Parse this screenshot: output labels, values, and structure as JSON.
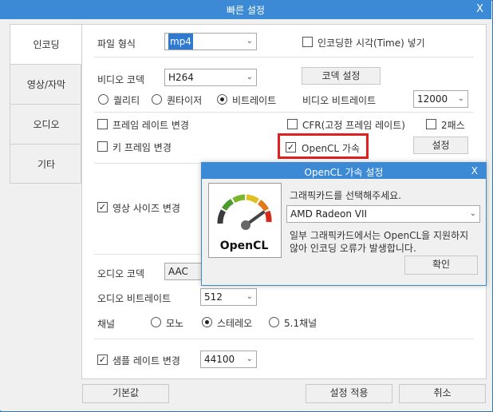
{
  "window": {
    "title": "빠른 설정",
    "close": "X"
  },
  "nav": {
    "items": [
      "인코딩",
      "영상/자막",
      "오디오",
      "기타"
    ]
  },
  "encoding": {
    "file_format_label": "파일 형식",
    "file_format_value": "mp4",
    "insert_time_label": "인코딩한 시각(Time) 넣기",
    "insert_time_checked": false,
    "video_codec_label": "비디오 코덱",
    "video_codec_value": "H264",
    "codec_settings_button": "코덱 설정",
    "modes": {
      "quality": "퀄리티",
      "quantizer": "퀀타이저",
      "bitrate": "비트레이트",
      "selected": "bitrate"
    },
    "video_bitrate_label": "비디오 비트레이트",
    "video_bitrate_value": "12000",
    "framerate_change_label": "프레임 레이트 변경",
    "cfr_label": "CFR(고정 프레임 레이트)",
    "two_pass_label": "2패스",
    "keyframe_change_label": "키 프레임 변경",
    "opencl_label": "OpenCL 가속",
    "opencl_checked": true,
    "settings_button": "설정",
    "resize_label": "영상 사이즈 변경",
    "resize_checked": true
  },
  "audio": {
    "codec_label": "오디오 코덱",
    "codec_value": "AAC",
    "bitrate_label": "오디오 비트레이트",
    "bitrate_value": "512",
    "channel_label": "채널",
    "mono": "모노",
    "stereo": "스테레오",
    "surround": "5.1채널",
    "selected_channel": "stereo",
    "samplerate_label": "샘플 레이트 변경",
    "samplerate_checked": true,
    "samplerate_value": "44100"
  },
  "bottom": {
    "default_button": "기본값",
    "apply_button": "설정 적용",
    "cancel_button": "취소"
  },
  "dialog": {
    "title": "OpenCL 가속 설정",
    "close": "X",
    "prompt": "그래픽카드를 선택해주세요.",
    "gpu_value": "AMD Radeon VII",
    "note_line1": "일부 그래픽카드에서는 OpenCL을 지원하지",
    "note_line2": "않아 인코딩 오류가 발생합니다.",
    "ok_button": "확인",
    "logo_text": "OpenCL"
  },
  "colors": {
    "accent": "#3c8ad6",
    "highlight": "#e02020"
  }
}
